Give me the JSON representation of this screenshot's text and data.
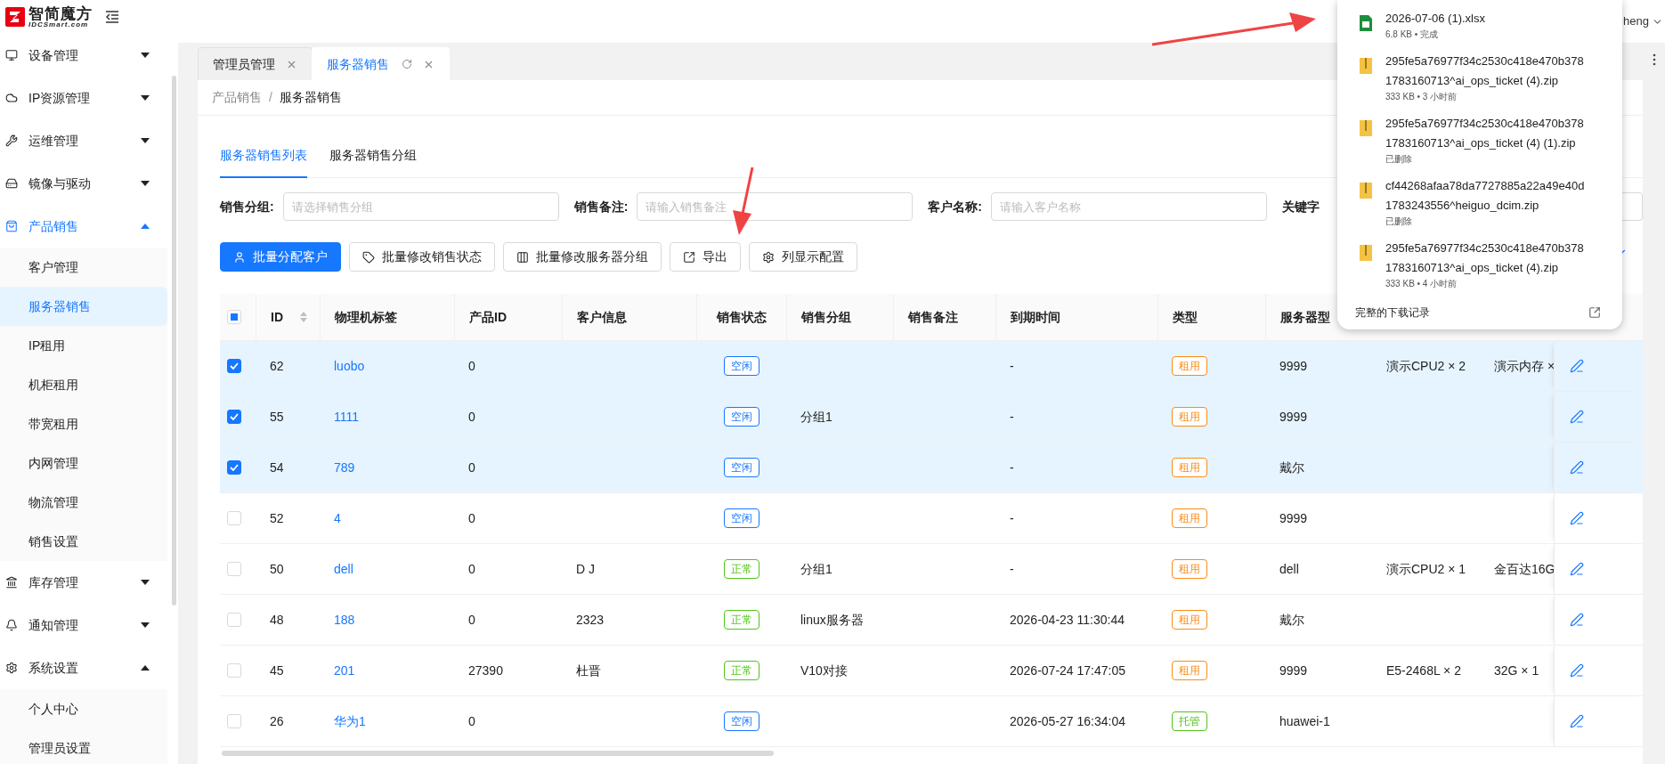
{
  "header": {
    "logo_title": "智简魔方",
    "logo_subtitle": "IDCSmart.com",
    "user": "heng"
  },
  "sidebar": {
    "items": [
      {
        "label": "设备管理",
        "active": false,
        "expanded": false
      },
      {
        "label": "IP资源管理",
        "active": false,
        "expanded": false
      },
      {
        "label": "运维管理",
        "active": false,
        "expanded": false
      },
      {
        "label": "镜像与驱动",
        "active": false,
        "expanded": false
      },
      {
        "label": "产品销售",
        "active": true,
        "expanded": true,
        "children": [
          {
            "label": "客户管理",
            "selected": false
          },
          {
            "label": "服务器销售",
            "selected": true
          },
          {
            "label": "IP租用",
            "selected": false
          },
          {
            "label": "机柜租用",
            "selected": false
          },
          {
            "label": "带宽租用",
            "selected": false
          },
          {
            "label": "内网管理",
            "selected": false
          },
          {
            "label": "物流管理",
            "selected": false
          },
          {
            "label": "销售设置",
            "selected": false
          }
        ]
      },
      {
        "label": "库存管理",
        "active": false,
        "expanded": false
      },
      {
        "label": "通知管理",
        "active": false,
        "expanded": false
      },
      {
        "label": "系统设置",
        "active": false,
        "expanded": true,
        "children": [
          {
            "label": "个人中心",
            "selected": false
          },
          {
            "label": "管理员设置",
            "selected": false
          }
        ]
      }
    ]
  },
  "tabs": [
    {
      "label": "管理员管理",
      "selected": false
    },
    {
      "label": "服务器销售",
      "selected": true
    }
  ],
  "breadcrumb": {
    "items": [
      "产品销售",
      "服务器销售"
    ],
    "separator": "/"
  },
  "subtabs": [
    {
      "label": "服务器销售列表",
      "selected": true
    },
    {
      "label": "服务器销售分组",
      "selected": false
    }
  ],
  "filters": [
    {
      "label": "销售分组:",
      "placeholder": "请选择销售分组"
    },
    {
      "label": "销售备注:",
      "placeholder": "请输入销售备注"
    },
    {
      "label": "客户名称:",
      "placeholder": "请输入客户名称"
    },
    {
      "label": "关键字"
    }
  ],
  "actions": [
    {
      "label": "批量分配客户",
      "kind": "primary"
    },
    {
      "label": "批量修改销售状态",
      "kind": "default"
    },
    {
      "label": "批量修改服务器分组",
      "kind": "default"
    },
    {
      "label": "导出",
      "kind": "default"
    },
    {
      "label": "列显示配置",
      "kind": "default"
    }
  ],
  "table": {
    "indeterminate": true,
    "columns": [
      "ID",
      "物理机标签",
      "产品ID",
      "客户信息",
      "销售状态",
      "销售分组",
      "销售备注",
      "到期时间",
      "类型",
      "服务器型"
    ],
    "rows": [
      {
        "selected": true,
        "id": "62",
        "tag": "luobo",
        "product_id": "0",
        "status": {
          "label": "空闲",
          "color": "#1677ff"
        },
        "expire": "-",
        "type": {
          "label": "租用",
          "color": "#fa8c16"
        },
        "model": "9999",
        "cpu": "演示CPU2 × 2",
        "memory": "演示内存 ×"
      },
      {
        "selected": true,
        "id": "55",
        "tag": "1111",
        "product_id": "0",
        "status": {
          "label": "空闲",
          "color": "#1677ff"
        },
        "group": "分组1",
        "expire": "-",
        "type": {
          "label": "租用",
          "color": "#fa8c16"
        },
        "model": "9999"
      },
      {
        "selected": true,
        "id": "54",
        "tag": "789",
        "product_id": "0",
        "status": {
          "label": "空闲",
          "color": "#1677ff"
        },
        "expire": "-",
        "type": {
          "label": "租用",
          "color": "#fa8c16"
        },
        "model": "戴尔"
      },
      {
        "selected": false,
        "id": "52",
        "tag": "4",
        "product_id": "0",
        "status": {
          "label": "空闲",
          "color": "#1677ff"
        },
        "expire": "-",
        "type": {
          "label": "租用",
          "color": "#fa8c16"
        },
        "model": "9999"
      },
      {
        "selected": false,
        "id": "50",
        "tag": "dell",
        "product_id": "0",
        "customer": "D J",
        "status": {
          "label": "正常",
          "color": "#52c41a"
        },
        "group": "分组1",
        "expire": "-",
        "type": {
          "label": "租用",
          "color": "#fa8c16"
        },
        "model": "dell",
        "cpu": "演示CPU2 × 1",
        "memory": "金百达16G"
      },
      {
        "selected": false,
        "id": "48",
        "tag": "188",
        "product_id": "0",
        "customer": "2323",
        "status": {
          "label": "正常",
          "color": "#52c41a"
        },
        "group": "linux服务器",
        "expire": "2026-04-23 11:30:44",
        "type": {
          "label": "租用",
          "color": "#fa8c16"
        },
        "model": "戴尔"
      },
      {
        "selected": false,
        "id": "45",
        "tag": "201",
        "product_id": "27390",
        "customer": "杜晋",
        "status": {
          "label": "正常",
          "color": "#52c41a"
        },
        "group": "V10对接",
        "expire": "2026-07-24 17:47:05",
        "type": {
          "label": "租用",
          "color": "#fa8c16"
        },
        "model": "9999",
        "cpu": "E5-2468L × 2",
        "memory": "32G × 1"
      },
      {
        "selected": false,
        "id": "26",
        "tag": "华为1",
        "product_id": "0",
        "status": {
          "label": "空闲",
          "color": "#1677ff"
        },
        "expire": "2026-05-27 16:34:04",
        "type": {
          "label": "托管",
          "color": "#52c41a"
        },
        "model": "huawei-1"
      }
    ]
  },
  "downloads": {
    "items": [
      {
        "kind": "sheet",
        "name": "2026-07-06 (1).xlsx",
        "meta": "6.8 KB • 完成"
      },
      {
        "kind": "zip",
        "name": "295fe5a76977f34c2530c418e470b378 1783160713^ai_ops_ticket (4).zip",
        "meta": "333 KB • 3 小时前"
      },
      {
        "kind": "zip",
        "name": "295fe5a76977f34c2530c418e470b378 1783160713^ai_ops_ticket (4) (1).zip",
        "meta": "已删除"
      },
      {
        "kind": "zip",
        "name": "cf44268afaa78da7727885a22a49e40d 1783243556^heiguo_dcim.zip",
        "meta": "已删除"
      },
      {
        "kind": "zip",
        "name": "295fe5a76977f34c2530c418e470b378 1783160713^ai_ops_ticket (4).zip",
        "meta": "333 KB • 4 小时前"
      }
    ],
    "footer": "完整的下载记录"
  }
}
